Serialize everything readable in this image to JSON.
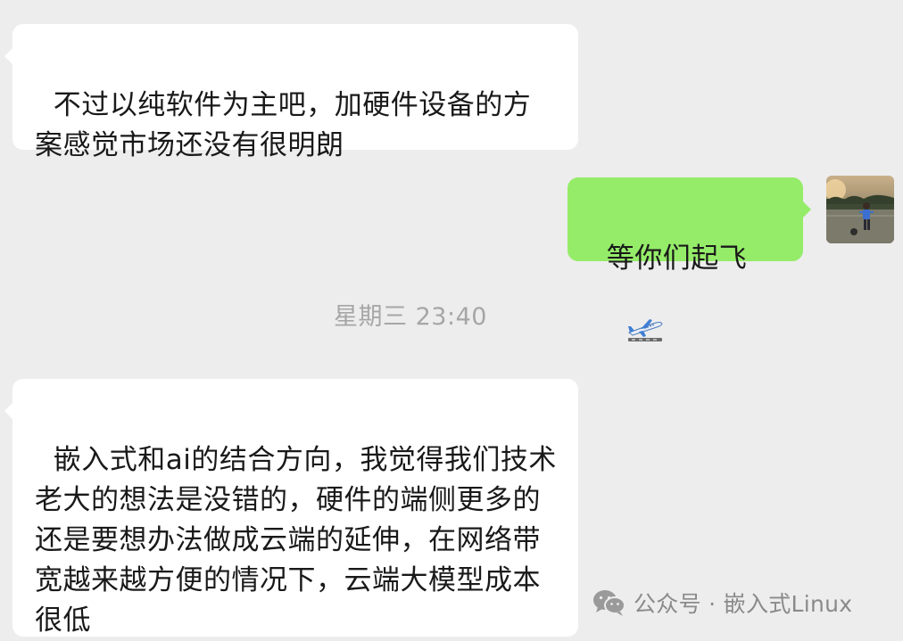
{
  "chat": {
    "messages": [
      {
        "direction": "incoming",
        "text": "不过以纯软件为主吧，加硬件设备的方案感觉市场还没有很明朗"
      },
      {
        "direction": "outgoing",
        "text": "等你们起飞",
        "emoji": "airplane-departure-icon"
      },
      {
        "direction": "incoming",
        "text": "嵌入式和ai的结合方向，我觉得我们技术老大的想法是没错的，硬件的端侧更多的还是要想办法做成云端的延伸，在网络带宽越来越方便的情况下，云端大模型成本很低"
      }
    ],
    "timestamp": "星期三 23:40"
  },
  "colors": {
    "background": "#ededed",
    "incoming_bubble": "#ffffff",
    "outgoing_bubble": "#95ec69",
    "timestamp_text": "#a6a6a6",
    "watermark_text": "#8a8a8a"
  },
  "watermark": {
    "icon": "wechat-icon",
    "text": "公众号 · 嵌入式Linux"
  }
}
